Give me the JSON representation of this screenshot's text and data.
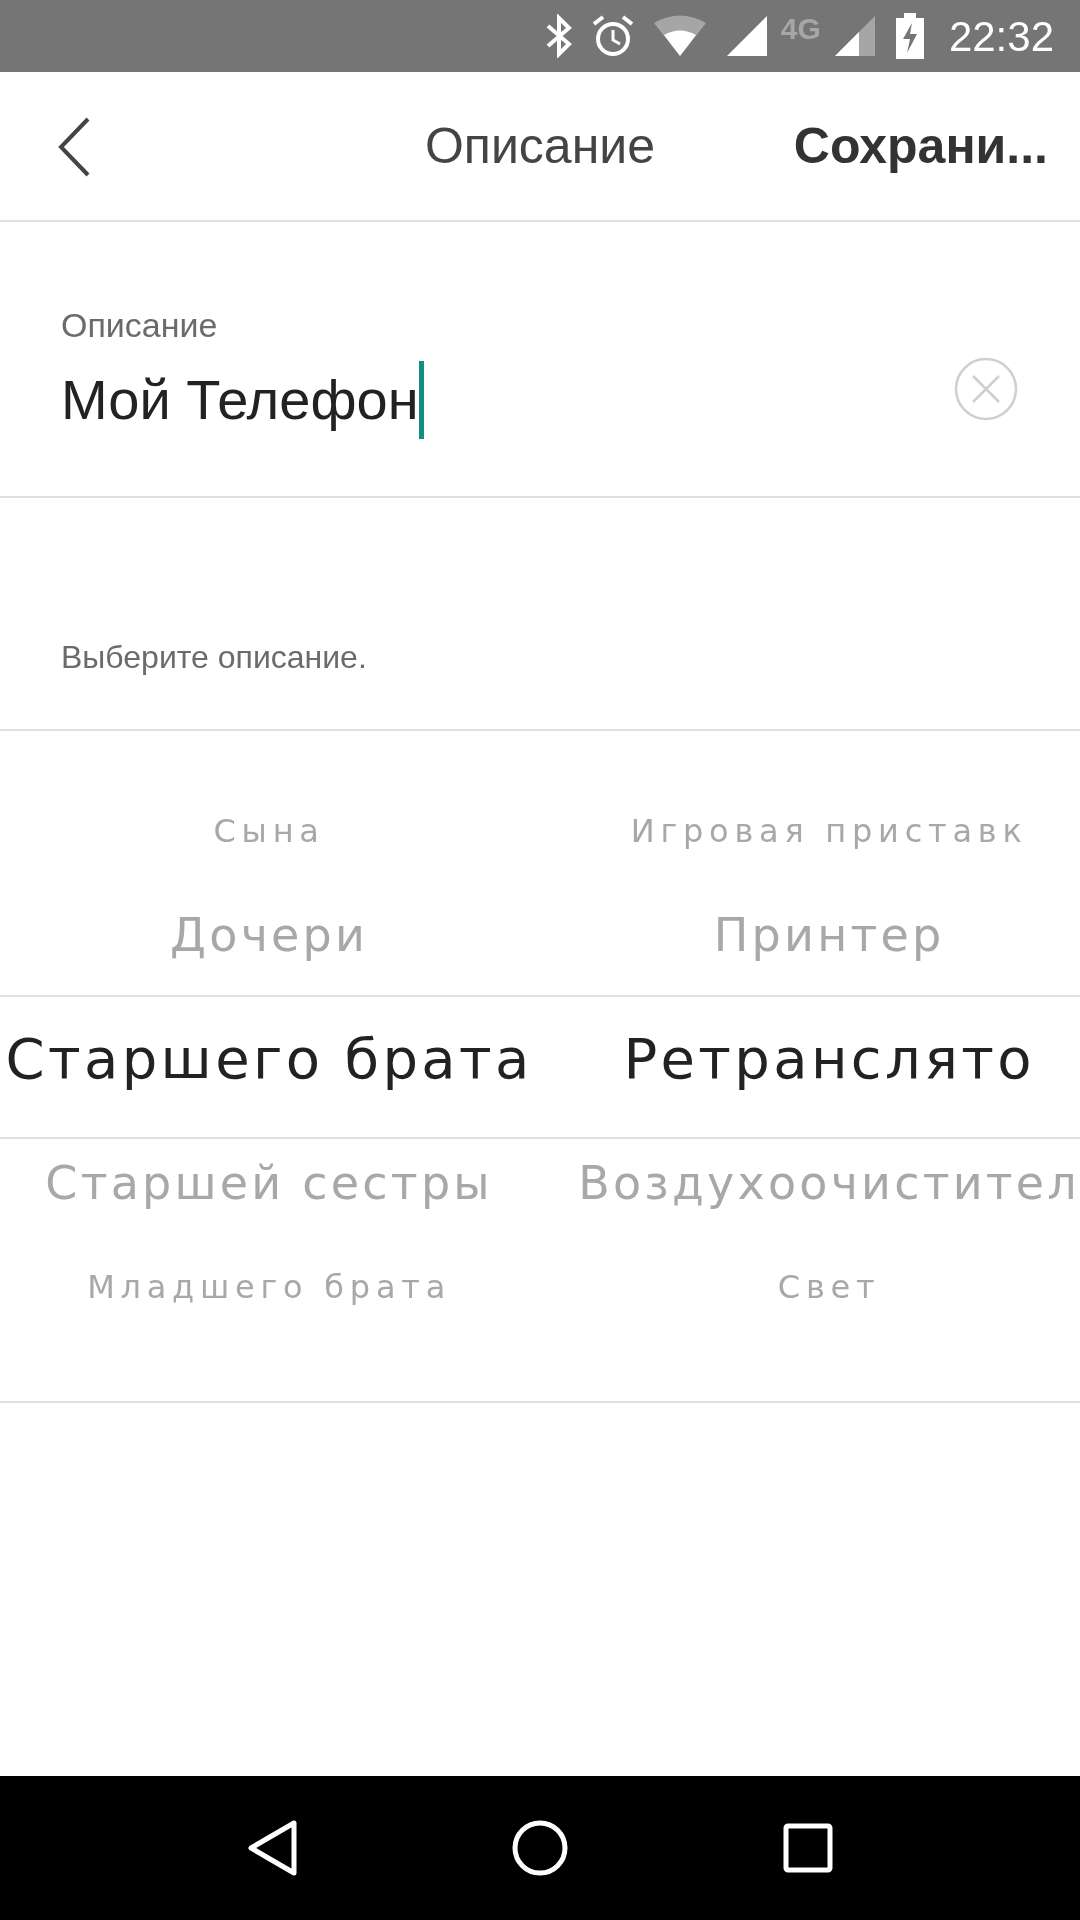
{
  "status_bar": {
    "network": "4G",
    "time": "22:32"
  },
  "header": {
    "title": "Описание",
    "action": "Сохрани..."
  },
  "field": {
    "label": "Описание",
    "value": "Мой Телефон",
    "focused": true
  },
  "hint": "Выберите описание.",
  "picker": {
    "columns": [
      {
        "items": [
          {
            "label": "Сына",
            "selected": false
          },
          {
            "label": "Дочери",
            "selected": false
          },
          {
            "label": "Старшего брата",
            "selected": true
          },
          {
            "label": "Старшей сестры",
            "selected": false
          },
          {
            "label": "Младшего брата",
            "selected": false
          }
        ]
      },
      {
        "items": [
          {
            "label": "Игровая приставк",
            "selected": false
          },
          {
            "label": "Принтер",
            "selected": false
          },
          {
            "label": "Ретранслято",
            "selected": true
          },
          {
            "label": "Воздухоочистител",
            "selected": false
          },
          {
            "label": "Свет",
            "selected": false
          }
        ]
      }
    ]
  }
}
